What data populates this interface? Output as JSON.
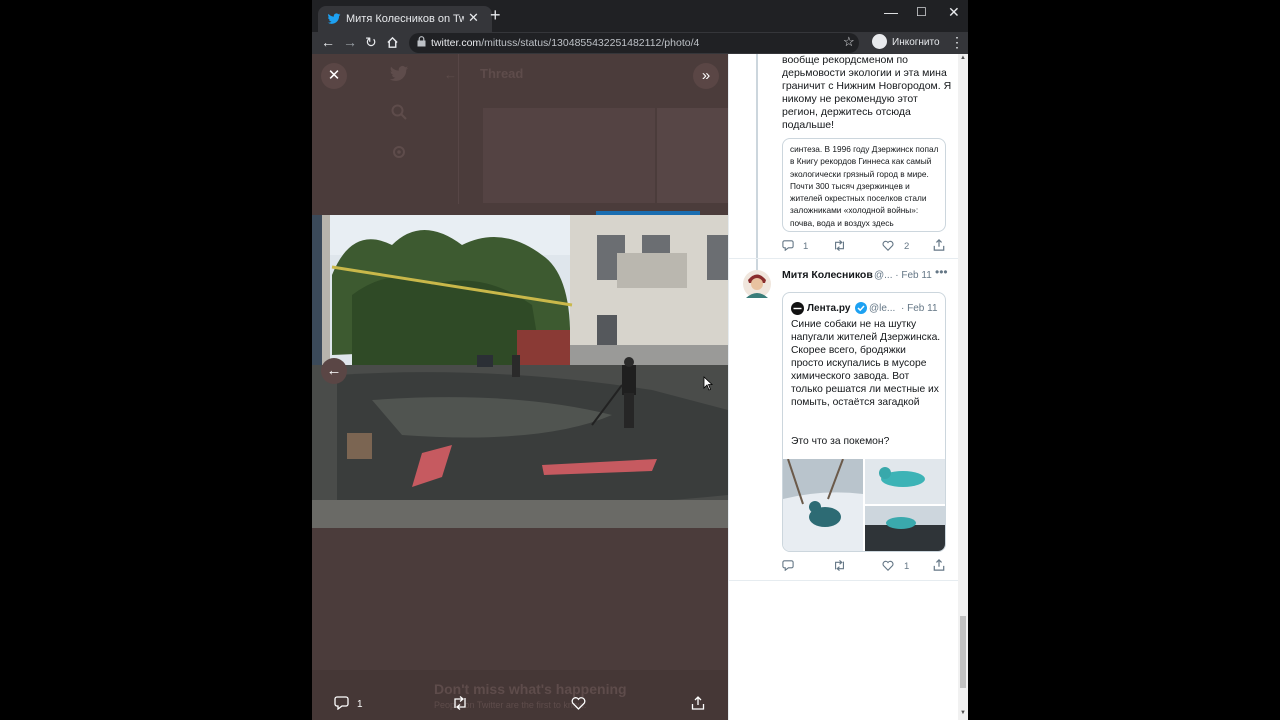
{
  "browser": {
    "tab_title": "Митя Колесников on Twitter: \"Т",
    "new_tab": "+",
    "url_domain": "twitter.com",
    "url_path": "/mittuss/status/1304855432251482112/photo/4",
    "profile_label": "Инкогнито",
    "window_controls": [
      "—",
      "☐",
      "✕"
    ]
  },
  "background_page": {
    "thread_header": "Thread",
    "dont_miss": "Don't miss what's happening",
    "dont_miss_sub": "People on Twitter are the first to know."
  },
  "media_viewer": {
    "reply_count": "1",
    "icons": [
      "close-icon",
      "expand-icon",
      "prev-arrow-icon",
      "reply-icon",
      "retweet-icon",
      "like-icon",
      "share-icon"
    ]
  },
  "reply1": {
    "text": "вообще рекордсменом по дерьмовости экологии и эта мина граничит с Нижним Новгородом. Я никому не рекомендую этот регион, держитесь отсюда подальше!",
    "card_text": "синтеза. В 1996 году Дзержинск попал в Книгу рекордов Гиннеса как самый экологически грязный город в мире. Почти 300 тысяч дзержинцев и жителей окрестных поселков стали заложниками «холодной войны»: почва, вода и воздух здесь",
    "reply_count": "1",
    "retweet_count": "",
    "like_count": "2"
  },
  "reply2": {
    "author": "Митя Колесников",
    "meta": "@... · Feb 11",
    "quoted_author": "Лента.ру",
    "quoted_handle": "@le...",
    "quoted_date": "· Feb 11",
    "quoted_text": "Синие собаки не на шутку напугали жителей Дзержинска. Скорее всего, бродяжки просто искупались в мусоре химического завода. Вот только решатся ли местные их помыть, остаётся загадкой",
    "quoted_text2": "Это что за покемон?",
    "reply_count": "",
    "retweet_count": "",
    "like_count": "1"
  },
  "colors": {
    "accent": "#1da1f2",
    "overlay": "#4b3c3b",
    "chrome_dark": "#202124",
    "chrome": "#35363a"
  }
}
